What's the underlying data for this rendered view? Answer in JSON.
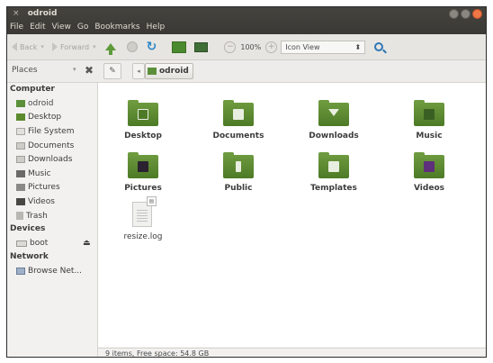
{
  "window": {
    "title": "odroid",
    "close_glyph": "×",
    "wm_buttons": [
      "close",
      "minimize",
      "maximize"
    ]
  },
  "menubar": {
    "items": [
      "File",
      "Edit",
      "View",
      "Go",
      "Bookmarks",
      "Help"
    ]
  },
  "toolbar": {
    "back_label": "Back",
    "forward_label": "Forward",
    "zoom_level": "100%",
    "view_mode": "Icon View",
    "colors": {
      "up": "#5d9a3a",
      "reload": "#2f87c7",
      "search": "#2f77b5"
    }
  },
  "locationbar": {
    "places_label": "Places",
    "crumb_label": "odroid"
  },
  "sidebar": {
    "sections": {
      "computer": "Computer",
      "devices": "Devices",
      "network": "Network"
    },
    "computer_items": [
      {
        "label": "odroid",
        "icon": "home-icon"
      },
      {
        "label": "Desktop",
        "icon": "desktop-icon"
      },
      {
        "label": "File System",
        "icon": "drive-icon"
      },
      {
        "label": "Documents",
        "icon": "documents-icon"
      },
      {
        "label": "Downloads",
        "icon": "downloads-icon"
      },
      {
        "label": "Music",
        "icon": "music-icon"
      },
      {
        "label": "Pictures",
        "icon": "pictures-icon"
      },
      {
        "label": "Videos",
        "icon": "videos-icon"
      },
      {
        "label": "Trash",
        "icon": "trash-icon"
      }
    ],
    "device_items": [
      {
        "label": "boot",
        "icon": "drive-icon"
      }
    ],
    "network_items": [
      {
        "label": "Browse Net...",
        "icon": "network-icon"
      }
    ]
  },
  "files": [
    {
      "name": "Desktop",
      "kind": "folder",
      "emblem": "desktop"
    },
    {
      "name": "Documents",
      "kind": "folder",
      "emblem": "document"
    },
    {
      "name": "Downloads",
      "kind": "folder",
      "emblem": "download"
    },
    {
      "name": "Music",
      "kind": "folder",
      "emblem": "music"
    },
    {
      "name": "Pictures",
      "kind": "folder",
      "emblem": "picture"
    },
    {
      "name": "Public",
      "kind": "folder",
      "emblem": "person"
    },
    {
      "name": "Templates",
      "kind": "folder",
      "emblem": "document"
    },
    {
      "name": "Videos",
      "kind": "folder",
      "emblem": "video"
    },
    {
      "name": "resize.log",
      "kind": "file",
      "emblem": "text"
    }
  ],
  "statusbar": {
    "text": "9 items, Free space: 54.8 GB"
  }
}
